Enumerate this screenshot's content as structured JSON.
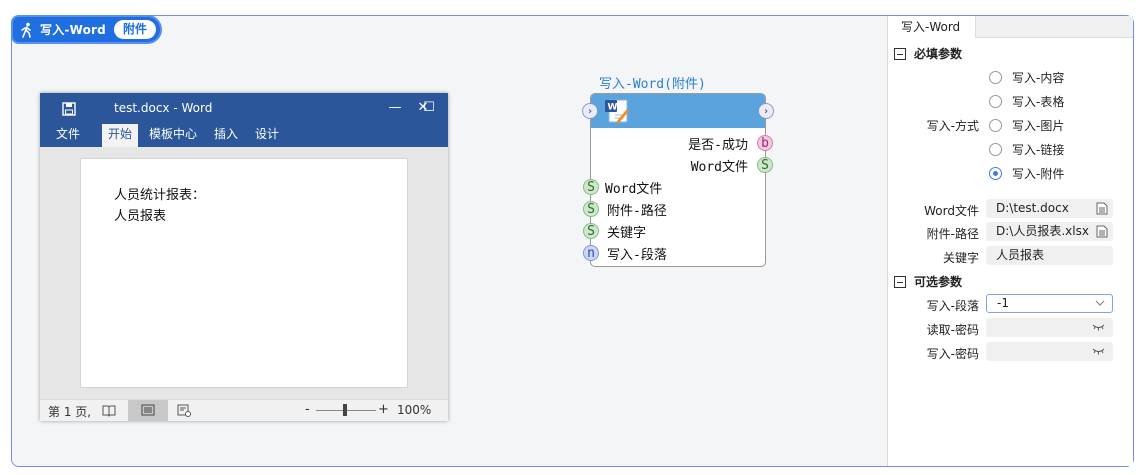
{
  "header": {
    "title": "写入-Word",
    "badge": "附件"
  },
  "word_window": {
    "doc_title": "test.docx  -  Word",
    "controls": {
      "minimize": "—",
      "maximize": "☐",
      "close": "✕"
    },
    "tabs": [
      "文件",
      "开始",
      "模板中心",
      "插入",
      "设计"
    ],
    "active_tab": "开始",
    "document_lines": [
      "人员统计报表：",
      "人员报表"
    ],
    "status": {
      "page": "第 1 页,",
      "zoom_minus": "-",
      "zoom_plus": "+",
      "zoom": "100%",
      "zoom_level": 0.45
    }
  },
  "node": {
    "title": "写入-Word(附件)",
    "outputs": [
      {
        "port": "b",
        "label": "是否-成功"
      },
      {
        "port": "S",
        "label": "Word文件"
      }
    ],
    "inputs": [
      {
        "port": "S",
        "label": "Word文件"
      },
      {
        "port": "S",
        "label": "附件-路径"
      },
      {
        "port": "S",
        "label": "关键字"
      },
      {
        "port": "n",
        "label": "写入-段落"
      }
    ]
  },
  "panel": {
    "tab": "写入-Word",
    "required_section": "必填参数",
    "mode_label": "写入-方式",
    "modes": [
      "写入-内容",
      "写入-表格",
      "写入-图片",
      "写入-链接",
      "写入-附件"
    ],
    "selected_mode": "写入-附件",
    "word_file_label": "Word文件",
    "word_file_value": "D:\\test.docx",
    "attach_path_label": "附件-路径",
    "attach_path_value": "D:\\人员报表.xlsx",
    "keyword_label": "关键字",
    "keyword_value": "人员报表",
    "optional_section": "可选参数",
    "paragraph_label": "写入-段落",
    "paragraph_value": "-1",
    "read_password_label": "读取-密码",
    "write_password_label": "写入-密码"
  },
  "colors": {
    "accent": "#1f6fe0",
    "word_blue": "#2b579a",
    "node_head": "#5aa3dc"
  }
}
